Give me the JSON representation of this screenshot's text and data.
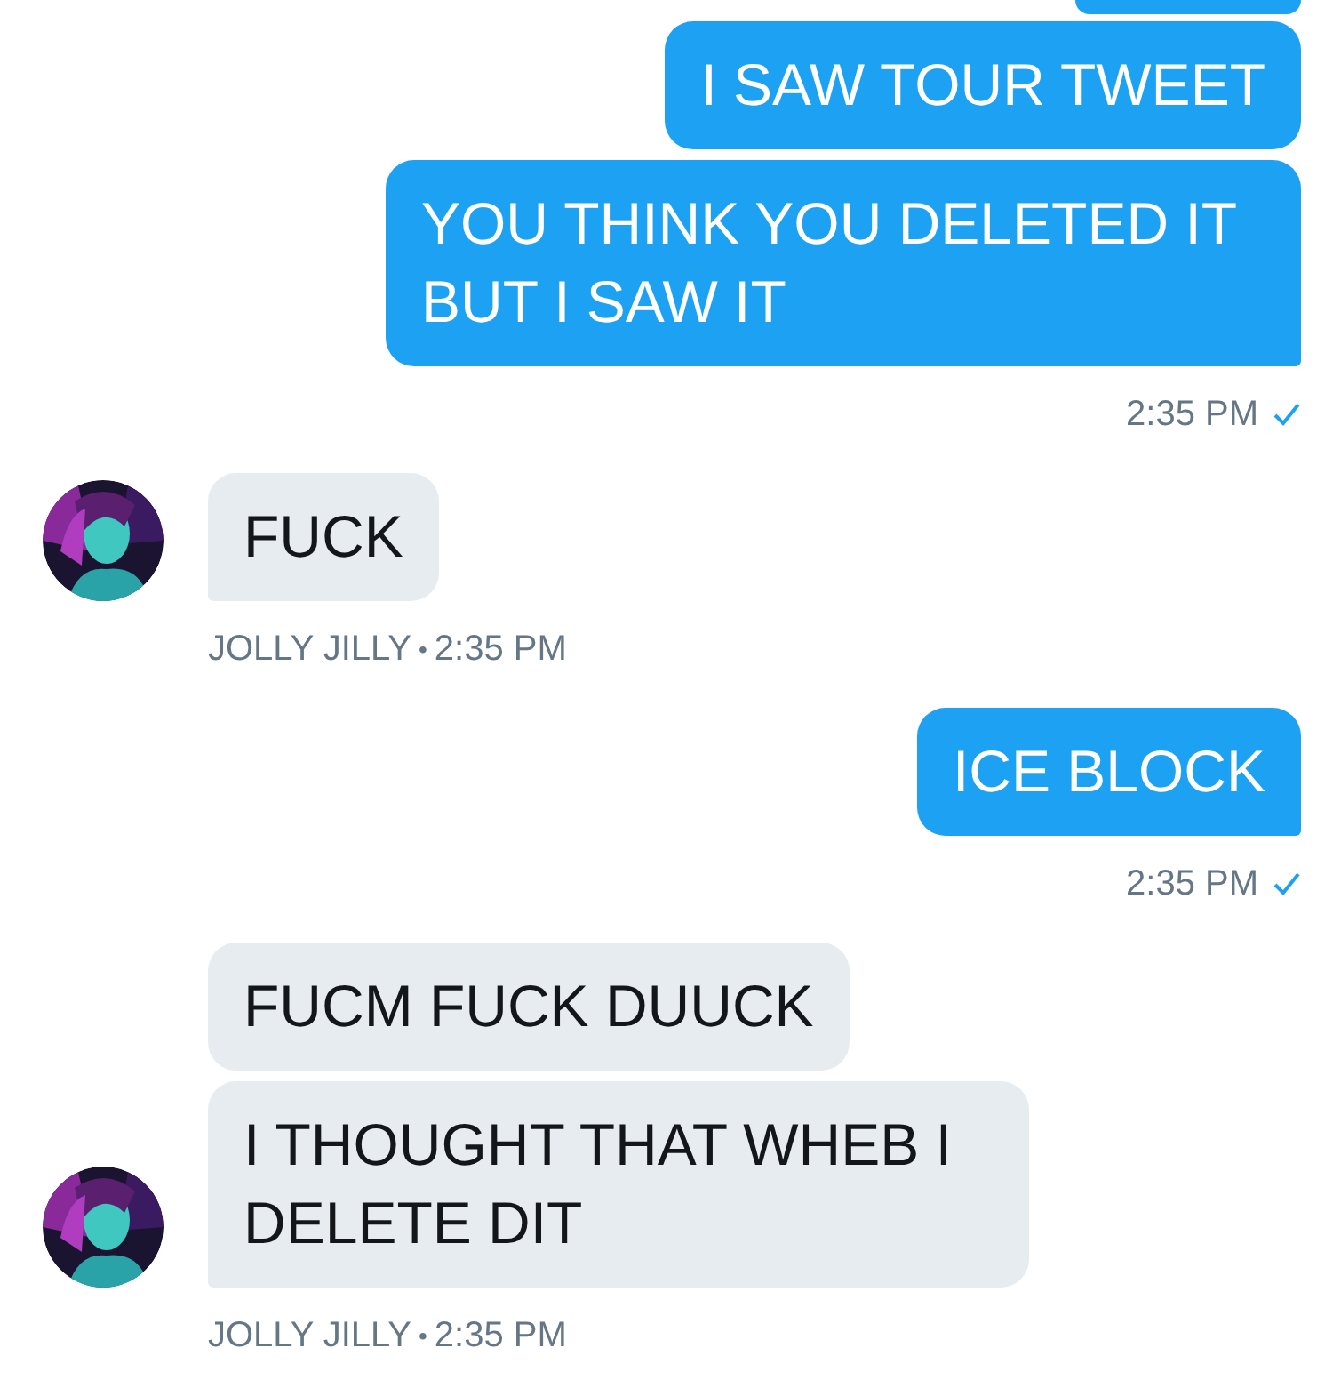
{
  "conversation": [
    {
      "kind": "sent",
      "bubbles": [
        {
          "kind": "partial"
        },
        {
          "kind": "text",
          "text": "I SAW TOUR TWEET",
          "tail": false
        },
        {
          "kind": "text",
          "text": "YOU THINK YOU DELETED IT BUT I SAW IT",
          "tail": true
        }
      ],
      "time": "2:35 PM",
      "read": true
    },
    {
      "kind": "received",
      "avatar": {
        "kind": "picture"
      },
      "bubbles": [
        {
          "kind": "text",
          "text": "FUCK",
          "tail": true
        }
      ],
      "sender": "JOLLY JILLY",
      "separator": "•",
      "time": "2:35 PM"
    },
    {
      "kind": "sent",
      "bubbles": [
        {
          "kind": "text",
          "text": "ICE BLOCK",
          "tail": true
        }
      ],
      "time": "2:35 PM",
      "read": true
    },
    {
      "kind": "received",
      "avatar": {
        "kind": "picture"
      },
      "bubbles": [
        {
          "kind": "text",
          "text": "FUCM FUCK DUUCK",
          "tail": false
        },
        {
          "kind": "text",
          "text": "I THOUGHT THAT WHEB I DELETE DIT",
          "tail": true
        }
      ],
      "sender": "JOLLY JILLY",
      "separator": "•",
      "time": "2:35 PM"
    }
  ]
}
